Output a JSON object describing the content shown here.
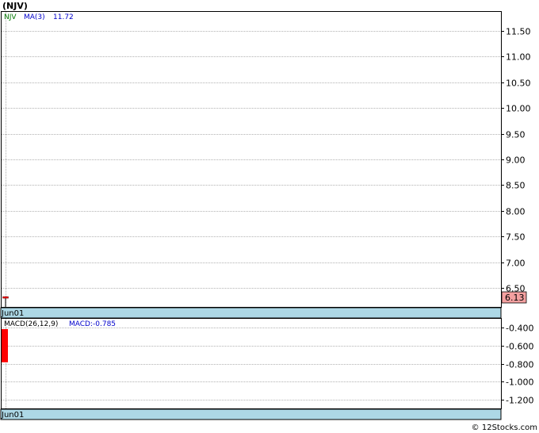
{
  "title": "(NJV)",
  "legend": {
    "ticker": "NJV",
    "ma_label": "MA(3)",
    "ma_value": "11.72"
  },
  "price_last_label": "6.13",
  "x_label_price": "Jun01",
  "macd_legend": {
    "label": "MACD(26,12,9)",
    "value_label": "MACD:-0.785"
  },
  "x_label_macd": "Jun01",
  "watermark": "© 12Stocks.com",
  "colors": {
    "up": "#ff0000",
    "ticker": "#007700",
    "ma": "#0000cc",
    "axis_band": "#add8e6",
    "last_box": "#f4a0a0"
  },
  "chart_data": [
    {
      "type": "candlestick",
      "ticker": "NJV",
      "x": [
        "Jun01"
      ],
      "candles": [
        {
          "date": "Jun01",
          "open": 6.13,
          "high": 6.33,
          "low": 6.0,
          "close": 6.33
        }
      ],
      "ylim": [
        6.13,
        11.87
      ],
      "yticks": [
        6.5,
        7.0,
        7.5,
        8.0,
        8.5,
        9.0,
        9.5,
        10.0,
        10.5,
        11.0,
        11.5
      ],
      "ytick_labels": [
        "6.50",
        "7.00",
        "7.50",
        "8.00",
        "8.50",
        "9.00",
        "9.50",
        "10.00",
        "10.50",
        "11.00",
        "11.50"
      ],
      "grid": true,
      "legend_position": "top-left"
    },
    {
      "type": "bar",
      "name": "MACD(26,12,9)",
      "x": [
        "Jun01"
      ],
      "values": [
        -0.785
      ],
      "ylim": [
        -1.3,
        -0.3
      ],
      "yticks": [
        -0.4,
        -0.6,
        -0.8,
        -1.0,
        -1.2
      ],
      "ytick_labels": [
        "-0.400",
        "-0.600",
        "-0.800",
        "-1.000",
        "-1.200"
      ],
      "grid": true
    }
  ]
}
